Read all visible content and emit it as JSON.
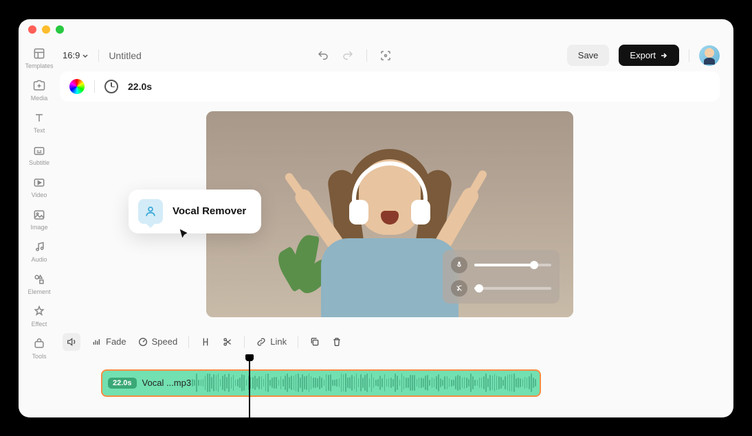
{
  "titlebar": {
    "dots": [
      "red",
      "yellow",
      "green"
    ]
  },
  "sidebar": {
    "items": [
      {
        "key": "templates",
        "label": "Templates"
      },
      {
        "key": "media",
        "label": "Media"
      },
      {
        "key": "text",
        "label": "Text"
      },
      {
        "key": "subtitle",
        "label": "Subtitle"
      },
      {
        "key": "video",
        "label": "Video"
      },
      {
        "key": "image",
        "label": "Image"
      },
      {
        "key": "audio",
        "label": "Audio"
      },
      {
        "key": "element",
        "label": "Element"
      },
      {
        "key": "effect",
        "label": "Effect"
      },
      {
        "key": "tools",
        "label": "Tools"
      }
    ]
  },
  "topbar": {
    "ratio": "16:9",
    "title": "Untitled",
    "save": "Save",
    "export": "Export"
  },
  "infobar": {
    "duration": "22.0s"
  },
  "popup": {
    "label": "Vocal Remover"
  },
  "audio_ctrl": {
    "vocal_level": 78,
    "music_level": 6
  },
  "toolrow": {
    "fade": "Fade",
    "speed": "Speed",
    "link": "Link"
  },
  "timeline": {
    "clip_duration": "22.0s",
    "clip_name": "Vocal ...mp3"
  }
}
